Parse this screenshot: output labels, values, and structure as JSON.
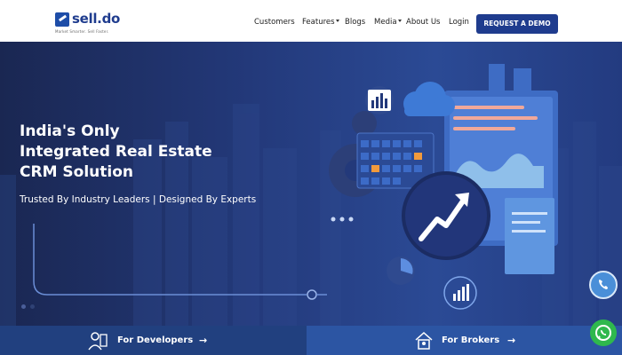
{
  "brand": {
    "name": "sell.do",
    "tagline": "Market Smarter. Sell Faster.",
    "brand_color": "#1f3c8e"
  },
  "nav": {
    "customers": "Customers",
    "features": "Features",
    "blogs": "Blogs",
    "media": "Media",
    "about": "About Us",
    "login": "Login",
    "cta": "REQUEST A DEMO"
  },
  "hero": {
    "title_line1": "India's Only",
    "title_line2": "Integrated Real Estate",
    "title_line3": "CRM Solution",
    "subtitle": "Trusted By Industry Leaders | Designed By Experts",
    "carousel_active_index": 0
  },
  "bottom": {
    "developers": "For Developers",
    "brokers": "For Brokers"
  },
  "icons": {
    "phone": "phone-icon",
    "whatsapp": "whatsapp-icon",
    "arrow": "arrow-right-icon"
  }
}
